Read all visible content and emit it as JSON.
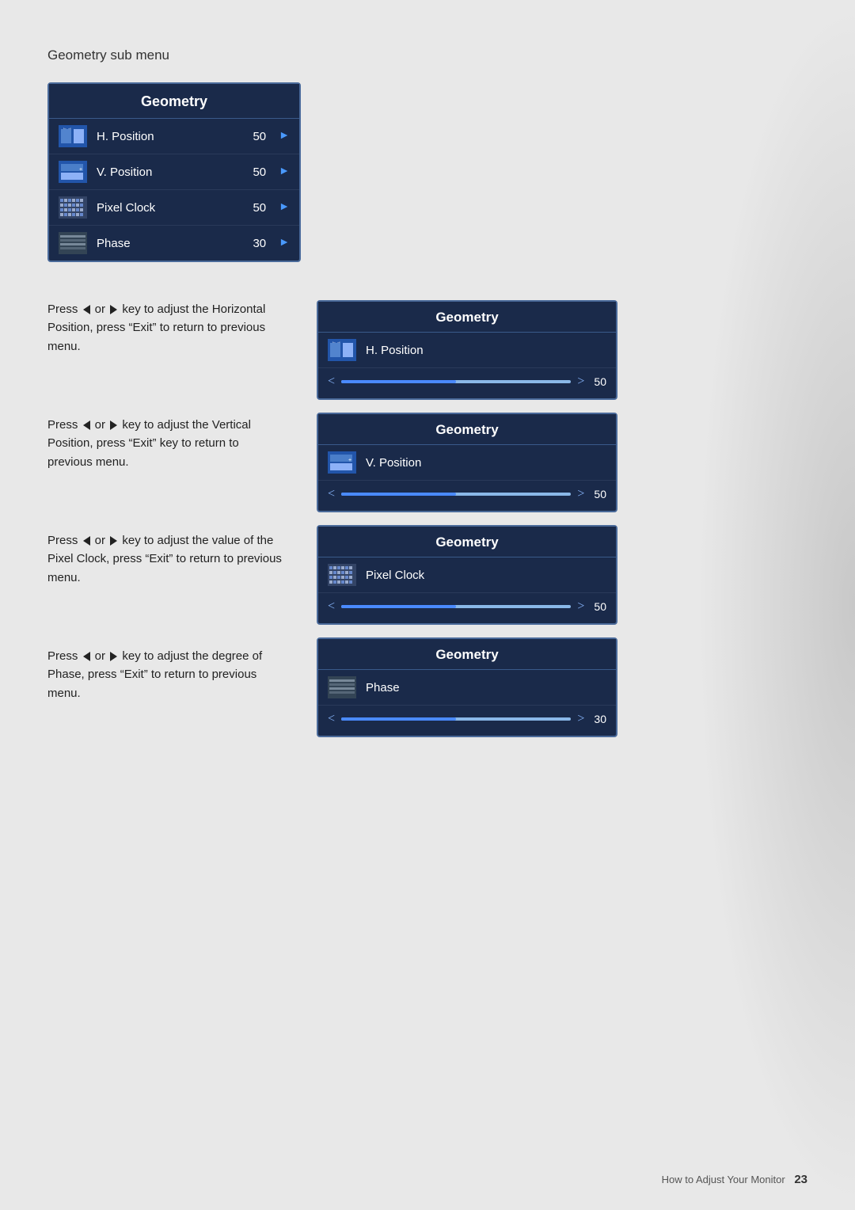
{
  "page": {
    "section_title": "Geometry sub menu",
    "footer_text": "How to Adjust Your Monitor",
    "footer_page": "23"
  },
  "main_menu": {
    "title": "Geometry",
    "items": [
      {
        "label": "H. Position",
        "value": "50",
        "icon": "h-position-icon"
      },
      {
        "label": "V. Position",
        "value": "50",
        "icon": "v-position-icon"
      },
      {
        "label": "Pixel Clock",
        "value": "50",
        "icon": "pixel-clock-icon"
      },
      {
        "label": "Phase",
        "value": "30",
        "icon": "phase-icon"
      }
    ]
  },
  "sub_panels": [
    {
      "title": "Geometry",
      "item_label": "H. Position",
      "icon": "h-position-icon",
      "value": "50",
      "slider_pct": 50
    },
    {
      "title": "Geometry",
      "item_label": "V. Position",
      "icon": "v-position-icon",
      "value": "50",
      "slider_pct": 50
    },
    {
      "title": "Geometry",
      "item_label": "Pixel Clock",
      "icon": "pixel-clock-icon",
      "value": "50",
      "slider_pct": 50
    },
    {
      "title": "Geometry",
      "item_label": "Phase",
      "icon": "phase-icon",
      "value": "30",
      "slider_pct": 50
    }
  ],
  "text_blocks": [
    {
      "id": "hpos-text",
      "text": "Press ◄ or ► key to adjust the Horizontal Position, press “Exit” to return to previous menu."
    },
    {
      "id": "vpos-text",
      "text": "Press ◄ or ► key to adjust the Vertical Position, press “Exit” key to return to previous menu."
    },
    {
      "id": "pclock-text",
      "text": "Press ◄ or ► key to adjust the value of the Pixel Clock, press “Exit” to return to previous menu."
    },
    {
      "id": "phase-text",
      "text": "Press ◄ or ► key to adjust the degree of Phase, press “Exit” to return to previous menu."
    }
  ]
}
